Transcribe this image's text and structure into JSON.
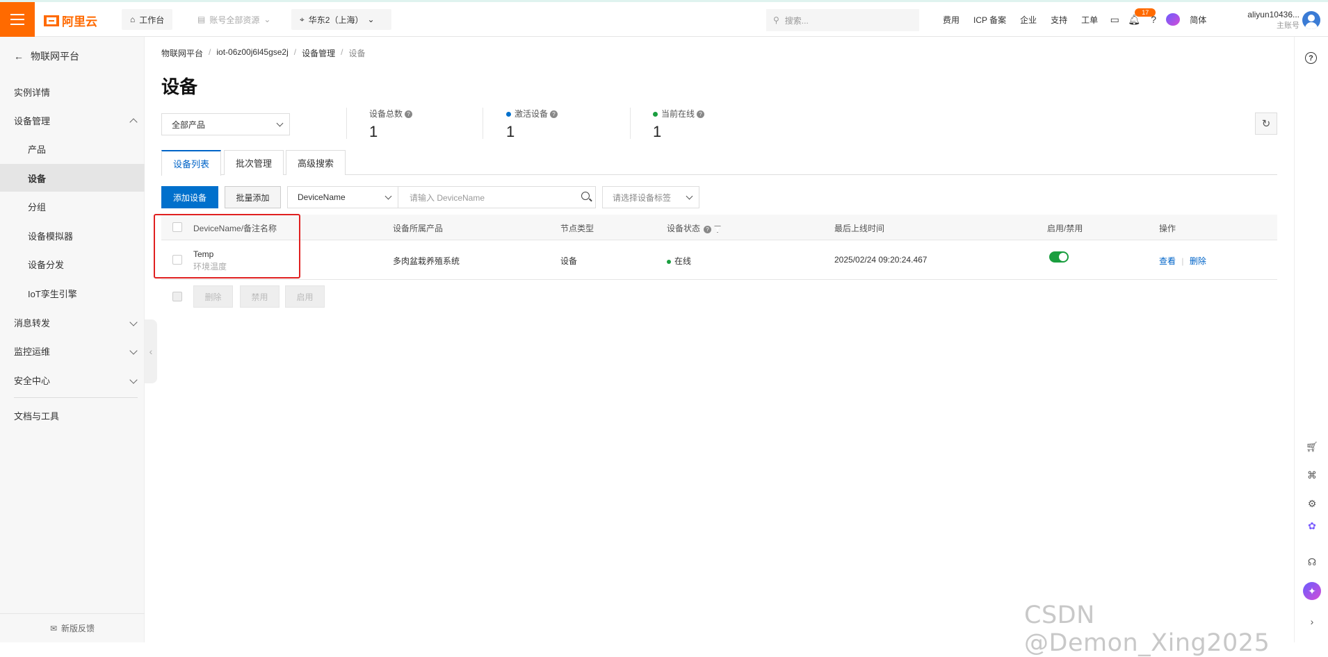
{
  "topbar": {
    "brand": "阿里云",
    "workbench": "工作台",
    "account_resources": "账号全部资源",
    "region": "华东2（上海）",
    "search_placeholder": "搜索...",
    "links": [
      "费用",
      "ICP 备案",
      "企业",
      "支持",
      "工单"
    ],
    "notification_count": "17",
    "lang": "简体",
    "username": "aliyun10436...",
    "account_type": "主账号"
  },
  "sidebar": {
    "back_label": "物联网平台",
    "items": [
      {
        "label": "实例详情"
      },
      {
        "label": "设备管理"
      },
      {
        "label": "产品"
      },
      {
        "label": "设备"
      },
      {
        "label": "分组"
      },
      {
        "label": "设备模拟器"
      },
      {
        "label": "设备分发"
      },
      {
        "label": "IoT孪生引擎"
      },
      {
        "label": "消息转发"
      },
      {
        "label": "监控运维"
      },
      {
        "label": "安全中心"
      },
      {
        "label": "文档与工具"
      }
    ],
    "feedback": "新版反馈"
  },
  "breadcrumb": [
    "物联网平台",
    "iot-06z00j6l45gse2j",
    "设备管理",
    "设备"
  ],
  "page_title": "设备",
  "product_filter": "全部产品",
  "stats": {
    "total_label": "设备总数",
    "total_value": "1",
    "activated_label": "激活设备",
    "activated_value": "1",
    "online_label": "当前在线",
    "online_value": "1",
    "activated_color": "#0070cc",
    "online_color": "#1a9e3f"
  },
  "tabs": [
    "设备列表",
    "批次管理",
    "高级搜索"
  ],
  "toolbar": {
    "add_device": "添加设备",
    "batch_add": "批量添加",
    "search_field": "DeviceName",
    "search_placeholder": "请输入 DeviceName",
    "tag_placeholder": "请选择设备标签"
  },
  "table": {
    "headers": [
      "DeviceName/备注名称",
      "设备所属产品",
      "节点类型",
      "设备状态",
      "最后上线时间",
      "启用/禁用",
      "操作"
    ],
    "rows": [
      {
        "name": "Temp",
        "remark": "环境温度",
        "product": "多肉盆栽养殖系统",
        "node_type": "设备",
        "status": "在线",
        "last_online": "2025/02/24 09:20:24.467",
        "enabled": true,
        "actions": [
          "查看",
          "删除"
        ]
      }
    ]
  },
  "bulk_actions": [
    "删除",
    "禁用",
    "启用"
  ],
  "watermark": "CSDN @Demon_Xing2025"
}
